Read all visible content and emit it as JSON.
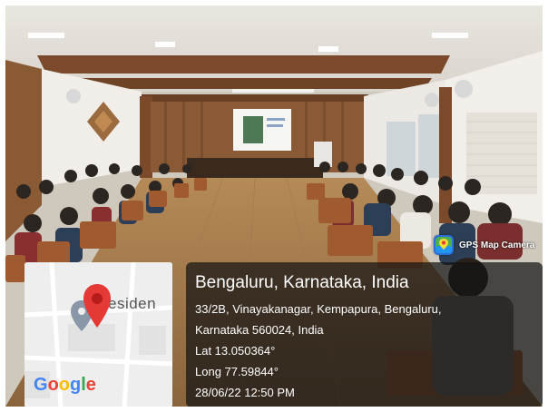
{
  "photo": {
    "description_icon": "photo-icon"
  },
  "badge": {
    "label": "GPS Map Camera",
    "icon": "map-pin-app-icon"
  },
  "map": {
    "label_fragment": "esiden",
    "brand": "Google",
    "brand_colors": [
      "#4285F4",
      "#EA4335",
      "#FBBC05",
      "#4285F4",
      "#34A853",
      "#EA4335"
    ],
    "pin_color": "#e53935"
  },
  "info": {
    "place": "Bengaluru, Karnataka, India",
    "address_line1": "33/2B, Vinayakanagar, Kempapura, Bengaluru,",
    "address_line2": "Karnataka 560024, India",
    "lat": "Lat 13.050364°",
    "long": "Long 77.59844°",
    "datetime": "28/06/22 12:50 PM"
  }
}
